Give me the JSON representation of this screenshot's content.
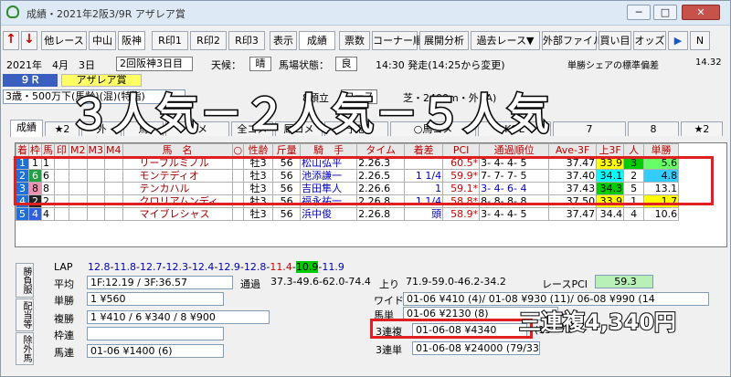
{
  "window": {
    "title": "成績・2021年2阪3/9R アザレア賞",
    "btn_min": "─",
    "btn_max": "□",
    "btn_close": "✕"
  },
  "toolbar": {
    "up": "↑",
    "down": "↓",
    "other_race": "他レース",
    "nakayama": "中山",
    "hanshin": "阪神",
    "r1": "R印1",
    "r2": "R印2",
    "r3": "R印3",
    "display": "表示",
    "results": "成績",
    "odds_ticket": "票数",
    "corner": "コーナー順",
    "pace": "展開分析",
    "past_race": "過去レース▼",
    "external": "外部ファイル",
    "buy": "買い目",
    "odds": "オッズ",
    "play": "▶",
    "next": "N"
  },
  "info": {
    "date": "2021年　4月　3日",
    "meeting": "2回阪神3日目",
    "weather_label": "天候：",
    "weather": "晴",
    "track_label": "馬場状態：",
    "track": "良",
    "start": "14:30 発走(14:25から変更)",
    "share_label": "単勝シェアの標準偏差",
    "share_value": "14.32",
    "race_no": "９Ｒ",
    "race_name": "アザレア賞",
    "conditions": "3歳・500万下(馬齢)(混)(特指)",
    "heads": "8頭立",
    "course_fig": "コース図",
    "course": "芝・2400m・外 (A)"
  },
  "overlay_top": "３人気－２人気－５人気",
  "tabs": [
    "成績",
    "★2",
    "外",
    "馬",
    "コメ",
    "全コメ",
    "厩コメ",
    "予想",
    "○馬コメ",
    "KOL",
    "7",
    "8",
    "★2"
  ],
  "grid": {
    "headers": [
      "着",
      "枠",
      "馬",
      "印",
      "M2",
      "M3",
      "M4",
      "馬　名",
      "○",
      "性齢",
      "斤量",
      "騎　手",
      "タイム",
      "着差",
      "PCI",
      "通過順位",
      "Ave-3F",
      "上3F",
      "人",
      "単勝"
    ],
    "rows": [
      [
        "1",
        "1",
        "1",
        "",
        "",
        "",
        "",
        "リーブルミノル",
        "",
        "牡3",
        "56",
        "松山弘平",
        "2.26.3",
        "",
        "60.5*",
        "3- 4- 4- 5",
        "37.47",
        "33.9",
        "3",
        "5.6"
      ],
      [
        "2",
        "6",
        "6",
        "",
        "",
        "",
        "",
        "モンテディオ",
        "",
        "牡3",
        "56",
        "池添謙一",
        "2.26.5",
        "1 1/4",
        "59.9*",
        "7- 7- 7- 5",
        "37.40",
        "34.1",
        "2",
        "4.8"
      ],
      [
        "3",
        "8",
        "8",
        "",
        "",
        "",
        "",
        "テンカハル",
        "",
        "牡3",
        "56",
        "吉田隼人",
        "2.26.6",
        "1",
        "59.1*",
        "3- 4- 6- 4",
        "37.43",
        "34.3",
        "5",
        "13.1"
      ],
      [
        "4",
        "2",
        "2",
        "",
        "",
        "",
        "",
        "クロリアムンディ",
        "",
        "牡3",
        "56",
        "福永祐一",
        "2.26.8",
        "1 1/4",
        "58.8*",
        "8- 8- 8- 8",
        "37.50",
        "33.9",
        "1",
        "1.7"
      ],
      [
        "5",
        "4",
        "4",
        "",
        "",
        "",
        "",
        "マイブレシャス",
        "",
        "牡3",
        "56",
        "浜中俊",
        "2.26.8",
        "頭",
        "58.9*",
        "3- 4- 4- 5",
        "37.47",
        "34.4",
        "4",
        "10.6"
      ]
    ]
  },
  "lower": {
    "lap_label": "LAP",
    "laps": [
      "12.8",
      "11.8",
      "12.7",
      "12.3",
      "12.4",
      "12.9",
      "12.8",
      "11.4",
      "10.9",
      "11.9"
    ],
    "avg_label": "平均",
    "avg": "1F:12.19 / 3F:36.57",
    "pass_label": "通過",
    "pass": "37.3-49.6-62.0-74.4",
    "last_label": "上り",
    "last": "71.9-59.0-46.2-34.2",
    "pci_label": "レースPCI",
    "pci": "59.3",
    "win_label": "単勝",
    "win": "1 ¥560",
    "wide_label": "ワイド",
    "wide": "01-06 ¥410 (4)/ 01-08 ¥930 (11)/ 06-08 ¥990 (14",
    "umatan_label": "馬単",
    "umatan": "01-06 ¥2130 (8)",
    "place_label": "複勝",
    "place": "1 ¥410 / 6 ¥340 / 8 ¥900",
    "trio_label": "3連複",
    "trio": "01-06-08 ¥4340",
    "trio_rank": "(13",
    "waku_label": "枠連",
    "trifecta_label": "3連単",
    "trifecta": "01-06-08 ¥24000 (79/336)",
    "quinella_label": "馬連",
    "quinella": "01-06 ¥1400 (6)",
    "side_tabs": [
      "勝負服",
      "配当等",
      "除外馬"
    ]
  },
  "overlay_bottom": "三連複4,340円"
}
